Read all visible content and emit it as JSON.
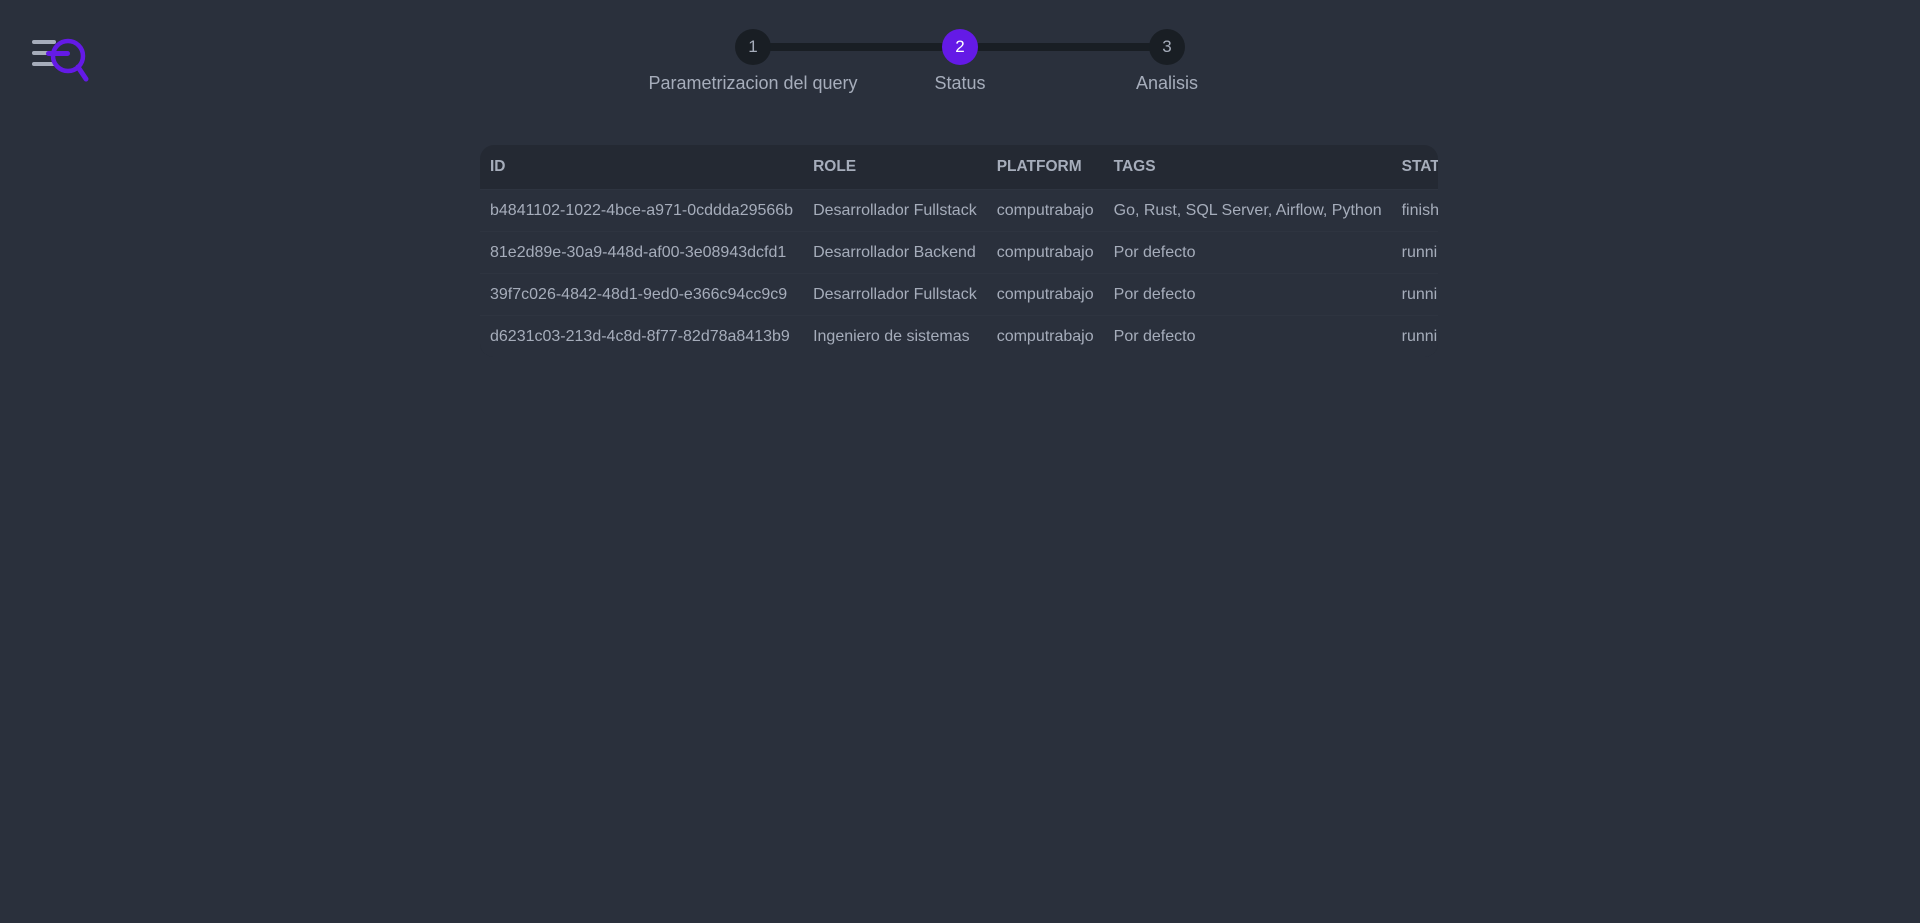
{
  "logo": {
    "icon": "menu-search-icon",
    "accent": "#641ae6",
    "bars_color": "#a6adbb"
  },
  "stepper": {
    "active_color": "#641ae6",
    "steps": [
      {
        "number": "1",
        "label": "Parametrizacion del query",
        "active": false
      },
      {
        "number": "2",
        "label": "Status",
        "active": true
      },
      {
        "number": "3",
        "label": "Analisis",
        "active": false
      }
    ]
  },
  "table": {
    "headers": {
      "id": "ID",
      "role": "ROLE",
      "platform": "PLATFORM",
      "tags": "TAGS",
      "status": "STATUS"
    },
    "rows": [
      {
        "id": "b4841102-1022-4bce-a971-0cddda29566b",
        "role": "Desarrollador Fullstack",
        "platform": "computrabajo",
        "tags": "Go, Rust, SQL Server, Airflow, Python",
        "status": "finished"
      },
      {
        "id": "81e2d89e-30a9-448d-af00-3e08943dcfd1",
        "role": "Desarrollador Backend",
        "platform": "computrabajo",
        "tags": "Por defecto",
        "status": "running"
      },
      {
        "id": "39f7c026-4842-48d1-9ed0-e366c94cc9c9",
        "role": "Desarrollador Fullstack",
        "platform": "computrabajo",
        "tags": "Por defecto",
        "status": "running"
      },
      {
        "id": "d6231c03-213d-4c8d-8f77-82d78a8413b9",
        "role": "Ingeniero de sistemas",
        "platform": "computrabajo",
        "tags": "Por defecto",
        "status": "running"
      }
    ]
  }
}
